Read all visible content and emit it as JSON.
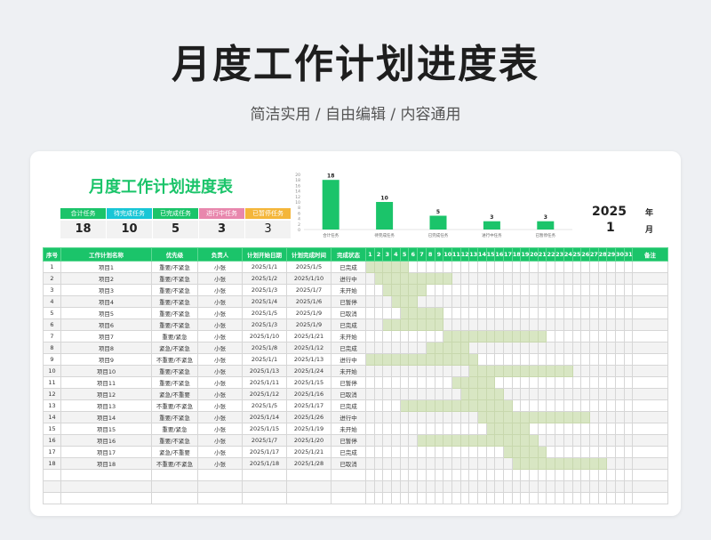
{
  "header": {
    "title": "月度工作计划进度表",
    "subtitle": "简洁实用 / 自由编辑 / 内容通用"
  },
  "sheet": {
    "title": "月度工作计划进度表",
    "year": "2025",
    "year_label": "年",
    "month": "1",
    "month_label": "月"
  },
  "colors": {
    "accent": "#1bc46a",
    "bar_fill": "#d8e6c3"
  },
  "stats": [
    {
      "label": "合计任务",
      "value": "18",
      "color": "#1bc46a"
    },
    {
      "label": "待完成任务",
      "value": "10",
      "color": "#18c6d6"
    },
    {
      "label": "已完成任务",
      "value": "5",
      "color": "#1bc46a"
    },
    {
      "label": "进行中任务",
      "value": "3",
      "color": "#e887ad"
    },
    {
      "label": "已暂停任务",
      "value": "3",
      "color": "#f4b63a"
    }
  ],
  "chart_data": {
    "type": "bar",
    "categories": [
      "合计任务",
      "待完成任务",
      "已完成任务",
      "进行中任务",
      "已暂停任务"
    ],
    "values": [
      18,
      10,
      5,
      3,
      3
    ],
    "yticks": [
      "0",
      "2",
      "4",
      "6",
      "8",
      "10",
      "12",
      "14",
      "16",
      "18",
      "20"
    ],
    "ylim": [
      0,
      20
    ],
    "color": "#1bc46a"
  },
  "table": {
    "headers": [
      "序号",
      "工作计划名称",
      "优先级",
      "负责人",
      "计划开始日期",
      "计划完成时间",
      "完成状态"
    ],
    "days": [
      "1",
      "2",
      "3",
      "4",
      "5",
      "6",
      "7",
      "8",
      "9",
      "10",
      "11",
      "12",
      "13",
      "14",
      "15",
      "16",
      "17",
      "18",
      "19",
      "20",
      "21",
      "22",
      "23",
      "24",
      "25",
      "26",
      "27",
      "28",
      "29",
      "30",
      "31"
    ],
    "note_header": "备注",
    "rows": [
      {
        "no": "1",
        "name": "项目1",
        "priority": "重要/不紧急",
        "owner": "小张",
        "start": "2025/1/1",
        "end": "2025/1/5",
        "status": "已完成",
        "s": 1,
        "e": 5
      },
      {
        "no": "2",
        "name": "项目2",
        "priority": "重要/不紧急",
        "owner": "小张",
        "start": "2025/1/2",
        "end": "2025/1/10",
        "status": "进行中",
        "s": 2,
        "e": 10
      },
      {
        "no": "3",
        "name": "项目3",
        "priority": "重要/不紧急",
        "owner": "小张",
        "start": "2025/1/3",
        "end": "2025/1/7",
        "status": "未开始",
        "s": 3,
        "e": 7
      },
      {
        "no": "4",
        "name": "项目4",
        "priority": "重要/不紧急",
        "owner": "小张",
        "start": "2025/1/4",
        "end": "2025/1/6",
        "status": "已暂停",
        "s": 4,
        "e": 6
      },
      {
        "no": "5",
        "name": "项目5",
        "priority": "重要/不紧急",
        "owner": "小张",
        "start": "2025/1/5",
        "end": "2025/1/9",
        "status": "已取消",
        "s": 5,
        "e": 9
      },
      {
        "no": "6",
        "name": "项目6",
        "priority": "重要/不紧急",
        "owner": "小张",
        "start": "2025/1/3",
        "end": "2025/1/9",
        "status": "已完成",
        "s": 3,
        "e": 9
      },
      {
        "no": "7",
        "name": "项目7",
        "priority": "重要/紧急",
        "owner": "小张",
        "start": "2025/1/10",
        "end": "2025/1/21",
        "status": "未开始",
        "s": 10,
        "e": 21
      },
      {
        "no": "8",
        "name": "项目8",
        "priority": "紧急/不紧急",
        "owner": "小张",
        "start": "2025/1/8",
        "end": "2025/1/12",
        "status": "已完成",
        "s": 8,
        "e": 12
      },
      {
        "no": "9",
        "name": "项目9",
        "priority": "不重要/不紧急",
        "owner": "小张",
        "start": "2025/1/1",
        "end": "2025/1/13",
        "status": "进行中",
        "s": 1,
        "e": 13
      },
      {
        "no": "10",
        "name": "项目10",
        "priority": "重要/不紧急",
        "owner": "小张",
        "start": "2025/1/13",
        "end": "2025/1/24",
        "status": "未开始",
        "s": 13,
        "e": 24
      },
      {
        "no": "11",
        "name": "项目11",
        "priority": "重要/不紧急",
        "owner": "小张",
        "start": "2025/1/11",
        "end": "2025/1/15",
        "status": "已暂停",
        "s": 11,
        "e": 15
      },
      {
        "no": "12",
        "name": "项目12",
        "priority": "紧急/不重要",
        "owner": "小张",
        "start": "2025/1/12",
        "end": "2025/1/16",
        "status": "已取消",
        "s": 12,
        "e": 16
      },
      {
        "no": "13",
        "name": "项目13",
        "priority": "不重要/不紧急",
        "owner": "小张",
        "start": "2025/1/5",
        "end": "2025/1/17",
        "status": "已完成",
        "s": 5,
        "e": 17
      },
      {
        "no": "14",
        "name": "项目14",
        "priority": "重要/不紧急",
        "owner": "小张",
        "start": "2025/1/14",
        "end": "2025/1/26",
        "status": "进行中",
        "s": 14,
        "e": 26
      },
      {
        "no": "15",
        "name": "项目15",
        "priority": "重要/紧急",
        "owner": "小张",
        "start": "2025/1/15",
        "end": "2025/1/19",
        "status": "未开始",
        "s": 15,
        "e": 19
      },
      {
        "no": "16",
        "name": "项目16",
        "priority": "重要/不紧急",
        "owner": "小张",
        "start": "2025/1/7",
        "end": "2025/1/20",
        "status": "已暂停",
        "s": 7,
        "e": 20
      },
      {
        "no": "17",
        "name": "项目17",
        "priority": "紧急/不重要",
        "owner": "小张",
        "start": "2025/1/17",
        "end": "2025/1/21",
        "status": "已完成",
        "s": 17,
        "e": 21
      },
      {
        "no": "18",
        "name": "项目18",
        "priority": "不重要/不紧急",
        "owner": "小张",
        "start": "2025/1/18",
        "end": "2025/1/28",
        "status": "已取消",
        "s": 18,
        "e": 28
      }
    ],
    "empty_rows": 3
  }
}
